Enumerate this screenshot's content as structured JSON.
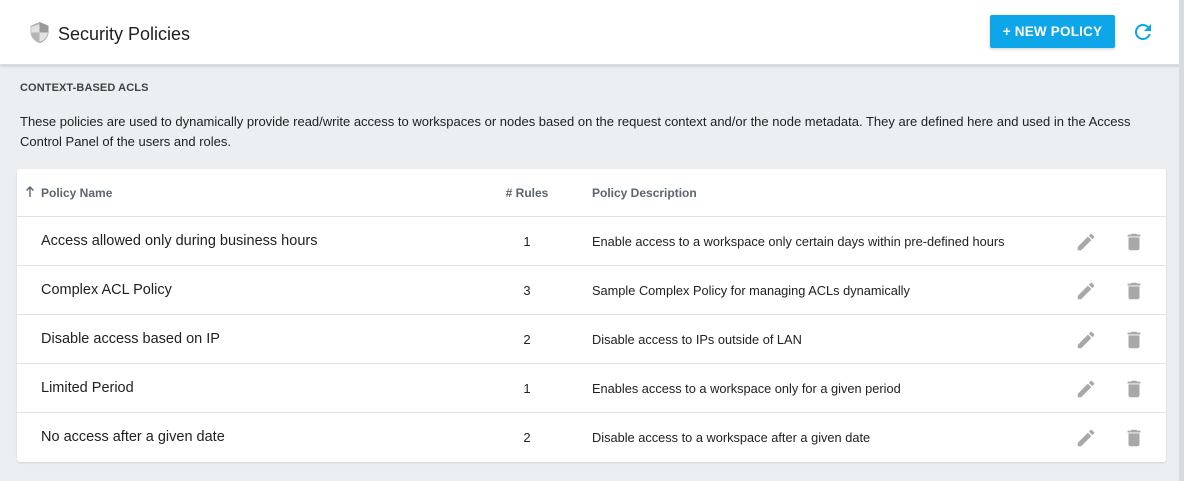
{
  "header": {
    "title": "Security Policies",
    "title_icon": "shield-icon",
    "new_policy_label": "+ NEW POLICY",
    "refresh_icon": "refresh-icon"
  },
  "section": {
    "title": "CONTEXT-BASED ACLS",
    "description": "These policies are used to dynamically provide read/write access to workspaces or nodes based on the request context and/or the node metadata. They are defined here and used in the Access Control Panel of the users and roles."
  },
  "table": {
    "columns": {
      "name": "Policy Name",
      "rules": "# Rules",
      "description": "Policy Description"
    },
    "sort": {
      "column": "name",
      "direction": "ascending",
      "icon": "arrow-up-icon"
    },
    "rows": [
      {
        "name": "Access allowed only during business hours",
        "rules": "1",
        "description": "Enable access to a workspace only certain days within pre-defined hours"
      },
      {
        "name": "Complex ACL Policy",
        "rules": "3",
        "description": "Sample Complex Policy for managing ACLs dynamically"
      },
      {
        "name": "Disable access based on IP",
        "rules": "2",
        "description": "Disable access to IPs outside of LAN"
      },
      {
        "name": "Limited Period",
        "rules": "1",
        "description": "Enables access to a workspace only for a given period"
      },
      {
        "name": "No access after a given date",
        "rules": "2",
        "description": "Disable access to a workspace after a given date"
      }
    ],
    "row_actions": [
      "pencil-icon",
      "trash-icon"
    ]
  },
  "colors": {
    "accent": "#0ca6e9",
    "background": "#eceff1",
    "card": "#ffffff",
    "icon_grey": "#9e9e9e"
  }
}
